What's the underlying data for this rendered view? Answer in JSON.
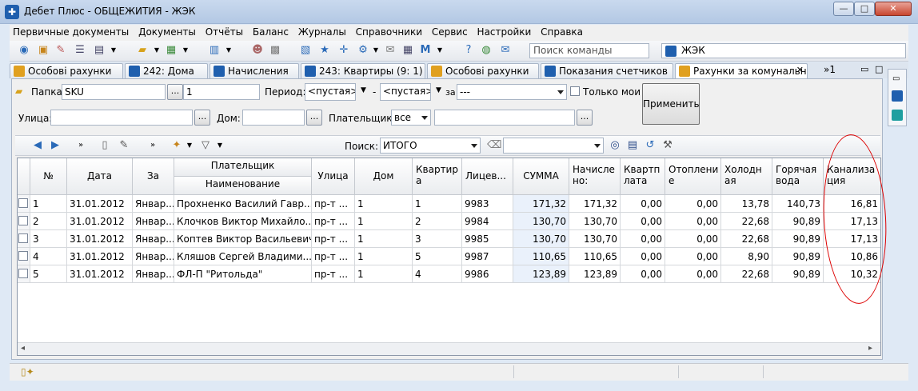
{
  "window": {
    "title": "Дебет Плюс - ОБЩЕЖИТИЯ - ЖЭК",
    "min_glyph": "—",
    "max_glyph": "□",
    "close_glyph": "✕"
  },
  "menu": [
    "Первичные документы",
    "Документы",
    "Отчёты",
    "Баланс",
    "Журналы",
    "Справочники",
    "Сервис",
    "Настройки",
    "Справка"
  ],
  "toolbar": {
    "command_search_placeholder": "Поиск команды",
    "org_value": "ЖЭК"
  },
  "tabs": [
    {
      "label": "Особові рахунки",
      "active": false
    },
    {
      "label": "242: Дома",
      "active": false
    },
    {
      "label": "Начисления",
      "active": false
    },
    {
      "label": "243: Квартиры (9: 1)",
      "active": false
    },
    {
      "label": "Особові рахунки",
      "active": false
    },
    {
      "label": "Показания счетчиков",
      "active": false
    },
    {
      "label": "Рахунки за комунальн",
      "active": true
    }
  ],
  "tabs_overflow": "»1",
  "filters": {
    "folder_label": "Папка",
    "folder_value": "SKU",
    "folder_num": "1",
    "period_label": "Период:",
    "period_from": "<пустая>",
    "period_dash": "-",
    "period_to": "<пустая>",
    "za_label": "за",
    "za_value": "---",
    "only_mine_label": "Только мои",
    "apply_label": "Применить",
    "street_label": "Улица:",
    "house_label": "Дом:",
    "payer_label": "Плательщик:",
    "payer_value": "все",
    "dots": "..."
  },
  "gridbar": {
    "search_label": "Поиск:",
    "search_value": "ИТОГО"
  },
  "grid": {
    "headers": {
      "num": "№",
      "date": "Дата",
      "za": "За",
      "payer": "Плательщик",
      "payer_name": "Наименование",
      "street": "Улица",
      "house": "Дом",
      "flat": "Квартир а",
      "account": "Лицев...",
      "sum": "СУММА",
      "accrued": "Начисле но:",
      "rent": "Квартп лата",
      "heating": "Отоплени е",
      "cold": "Холодн ая",
      "hot": "Горячая вода",
      "sewer": "Канализа ция"
    },
    "rows": [
      {
        "num": "1",
        "date": "31.01.2012",
        "za": "Январ...",
        "name": "Прохненко Василий Гавр...",
        "street": "пр-т ...",
        "house": "1",
        "flat": "1",
        "account": "9983",
        "sum": "171,32",
        "accrued": "171,32",
        "rent": "0,00",
        "heating": "0,00",
        "cold": "13,78",
        "hot": "140,73",
        "sewer": "16,81"
      },
      {
        "num": "2",
        "date": "31.01.2012",
        "za": "Январ...",
        "name": "Клочков Виктор Михайло...",
        "street": "пр-т ...",
        "house": "1",
        "flat": "2",
        "account": "9984",
        "sum": "130,70",
        "accrued": "130,70",
        "rent": "0,00",
        "heating": "0,00",
        "cold": "22,68",
        "hot": "90,89",
        "sewer": "17,13"
      },
      {
        "num": "3",
        "date": "31.01.2012",
        "za": "Январ...",
        "name": "Коптев Виктор Васильевич",
        "street": "пр-т ...",
        "house": "1",
        "flat": "3",
        "account": "9985",
        "sum": "130,70",
        "accrued": "130,70",
        "rent": "0,00",
        "heating": "0,00",
        "cold": "22,68",
        "hot": "90,89",
        "sewer": "17,13"
      },
      {
        "num": "4",
        "date": "31.01.2012",
        "za": "Январ...",
        "name": "Кляшов Сергей Владими...",
        "street": "пр-т ...",
        "house": "1",
        "flat": "5",
        "account": "9987",
        "sum": "110,65",
        "accrued": "110,65",
        "rent": "0,00",
        "heating": "0,00",
        "cold": "8,90",
        "hot": "90,89",
        "sewer": "10,86"
      },
      {
        "num": "5",
        "date": "31.01.2012",
        "za": "Январ...",
        "name": "ФЛ-П \"Ритольда\"",
        "street": "пр-т ...",
        "house": "1",
        "flat": "4",
        "account": "9986",
        "sum": "123,89",
        "accrued": "123,89",
        "rent": "0,00",
        "heating": "0,00",
        "cold": "22,68",
        "hot": "90,89",
        "sewer": "10,32"
      }
    ]
  },
  "colors": {
    "accent": "#1f5fae",
    "annotation": "#dd0000",
    "sum_bg": "#eaf1fb"
  }
}
